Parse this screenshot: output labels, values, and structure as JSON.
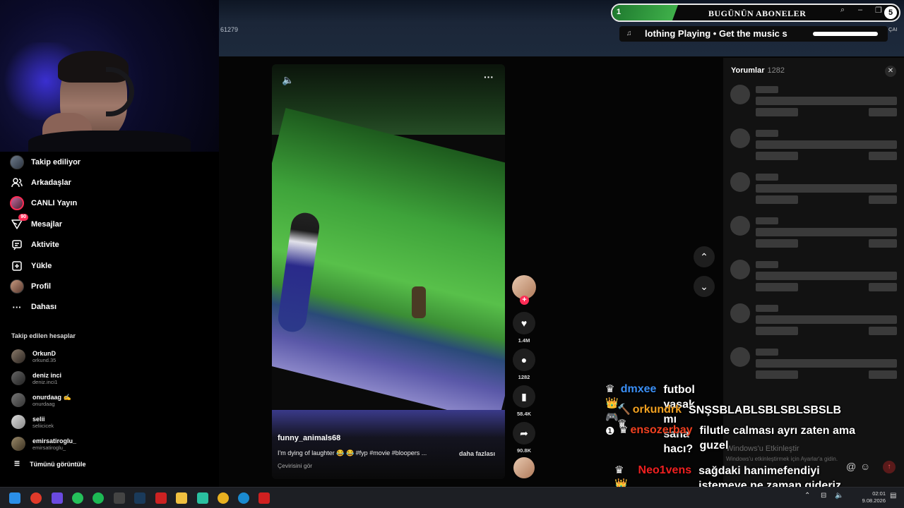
{
  "browser": {
    "id_text": "61279"
  },
  "sidebar": {
    "nav": [
      {
        "label": "Takip ediliyor",
        "icon": "following-avatar-icon"
      },
      {
        "label": "Arkadaşlar",
        "icon": "friends-icon"
      },
      {
        "label": "CANLI Yayın",
        "icon": "live-icon"
      },
      {
        "label": "Mesajlar",
        "icon": "messages-icon",
        "badge": "90"
      },
      {
        "label": "Aktivite",
        "icon": "activity-icon"
      },
      {
        "label": "Yükle",
        "icon": "upload-icon"
      },
      {
        "label": "Profil",
        "icon": "profile-icon"
      },
      {
        "label": "Dahası",
        "icon": "more-icon"
      }
    ],
    "following_title": "Takip edilen hesaplar",
    "accounts": [
      {
        "name": "OrkunD",
        "handle": "orkund.35"
      },
      {
        "name": "deniz inci",
        "handle": "deniz.inci1"
      },
      {
        "name": "onurdaag ✍",
        "handle": "onurdaag"
      },
      {
        "name": "selii",
        "handle": "seliicicek"
      },
      {
        "name": "emirsatiroglu_",
        "handle": "emirsatiroglu_"
      }
    ],
    "see_all": "Tümünü görüntüle"
  },
  "video": {
    "username": "funny_animals68",
    "description": "I'm dying of laughter 😂 😂 #fyp #movie #bloopers ...",
    "more": "daha fazlası",
    "translate": "Çevirisini gör",
    "likes": "1.4M",
    "comments": "1282",
    "saves": "58.4K",
    "shares": "90.8K"
  },
  "comments_panel": {
    "title": "Yorumlar",
    "count": "1282",
    "close": "✕"
  },
  "chat": [
    {
      "user": "dmxee",
      "color": "#3b8ff5",
      "icons": "♛👑🎮❶",
      "text": "futbol yasak mı sana hacı?"
    },
    {
      "user": "orkundrk",
      "color": "#f0a020",
      "icons": "🔨♛",
      "text": "SNŞSBLABLSBLSBLSBSLB"
    },
    {
      "user": "ensozerbay",
      "color": "#f04020",
      "icons": "♛",
      "text": "filutle calması ayrı zaten ama guzel"
    },
    {
      "user": "Neo1vens",
      "color": "#f02020",
      "icons": "♛👑",
      "text": "sağdaki hanimefendiyi istemeye ne zaman gideriz"
    }
  ],
  "sub_goal": {
    "current": "1",
    "label": "BUGÜNÜN ABONELER",
    "goal": "5",
    "progress": 0.2
  },
  "now_playing": {
    "text": "lothing Playing • Get the music s",
    "ai_label": "ÇAI"
  },
  "watermark": {
    "line1": "Windows'u Etkinleştir",
    "line2": "Windows'u etkinleştirmek için Ayarlar'a gidin."
  },
  "clock": {
    "time": "02:01",
    "date": "9.08.2026"
  }
}
